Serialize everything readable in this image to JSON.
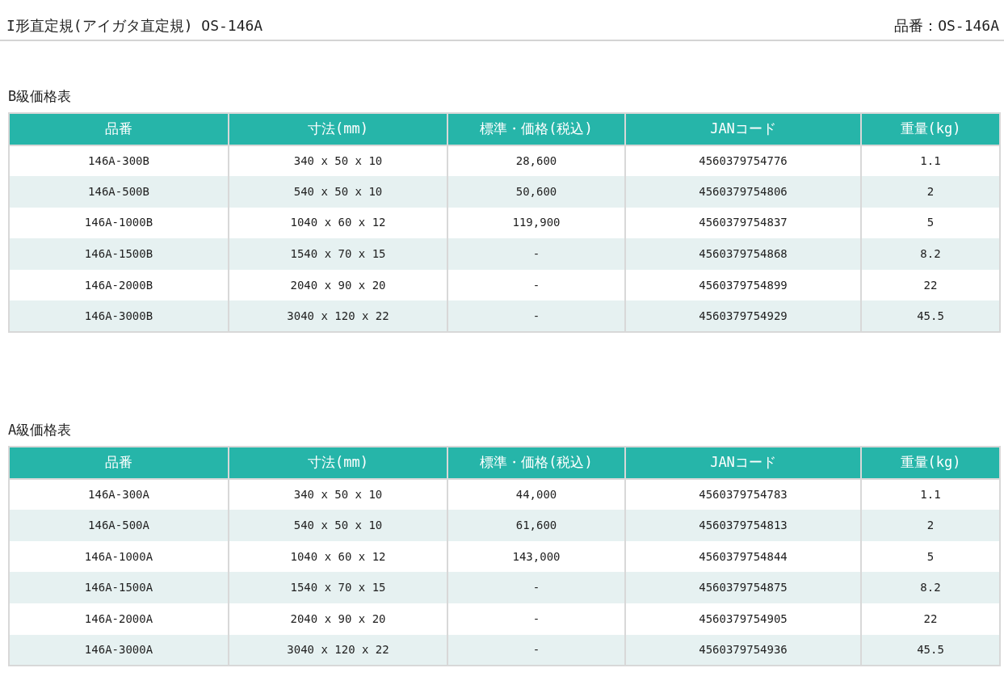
{
  "header": {
    "title": "I形直定規(アイガタ直定規) OS-146A",
    "part_number": "品番：OS-146A"
  },
  "tables": [
    {
      "caption": "B級価格表",
      "columns": [
        "品番",
        "寸法(mm)",
        "標準・価格(税込)",
        "JANコード",
        "重量(kg)"
      ],
      "rows": [
        [
          "146A-300B",
          "340 x 50 x 10",
          "28,600",
          "4560379754776",
          "1.1"
        ],
        [
          "146A-500B",
          "540 x 50 x 10",
          "50,600",
          "4560379754806",
          "2"
        ],
        [
          "146A-1000B",
          "1040 x 60 x 12",
          "119,900",
          "4560379754837",
          "5"
        ],
        [
          "146A-1500B",
          "1540 x 70 x 15",
          "-",
          "4560379754868",
          "8.2"
        ],
        [
          "146A-2000B",
          "2040 x 90 x 20",
          "-",
          "4560379754899",
          "22"
        ],
        [
          "146A-3000B",
          "3040 x 120 x 22",
          "-",
          "4560379754929",
          "45.5"
        ]
      ]
    },
    {
      "caption": "A級価格表",
      "columns": [
        "品番",
        "寸法(mm)",
        "標準・価格(税込)",
        "JANコード",
        "重量(kg)"
      ],
      "rows": [
        [
          "146A-300A",
          "340 x 50 x 10",
          "44,000",
          "4560379754783",
          "1.1"
        ],
        [
          "146A-500A",
          "540 x 50 x 10",
          "61,600",
          "4560379754813",
          "2"
        ],
        [
          "146A-1000A",
          "1040 x 60 x 12",
          "143,000",
          "4560379754844",
          "5"
        ],
        [
          "146A-1500A",
          "1540 x 70 x 15",
          "-",
          "4560379754875",
          "8.2"
        ],
        [
          "146A-2000A",
          "2040 x 90 x 20",
          "-",
          "4560379754905",
          "22"
        ],
        [
          "146A-3000A",
          "3040 x 120 x 22",
          "-",
          "4560379754936",
          "45.5"
        ]
      ]
    }
  ]
}
